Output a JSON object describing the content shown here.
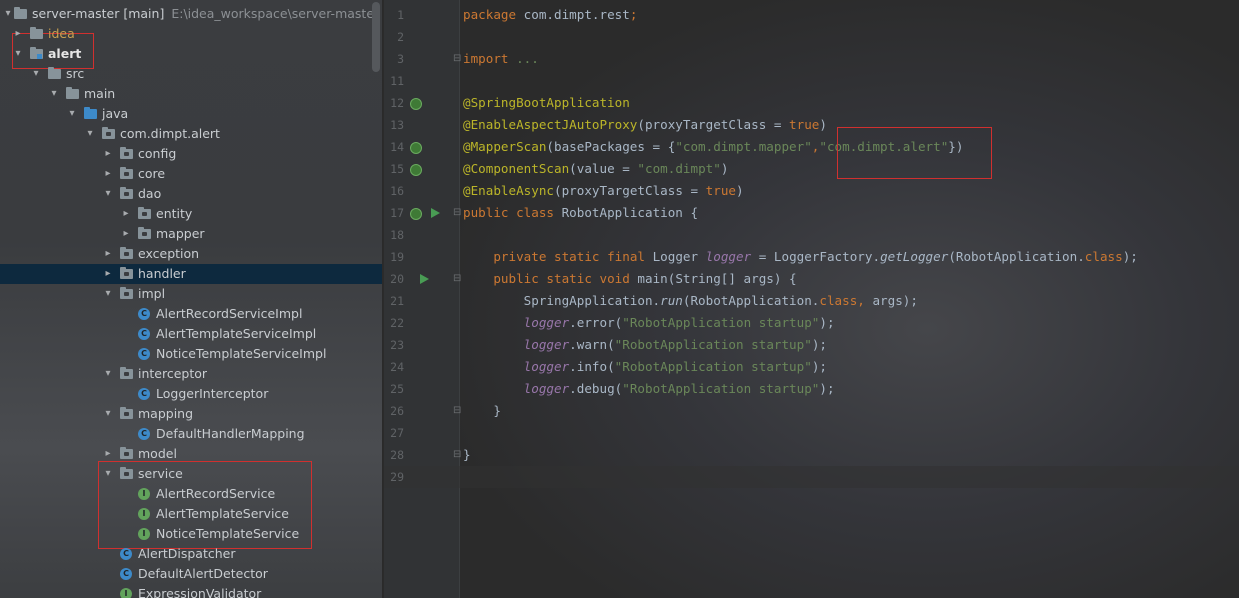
{
  "tree": {
    "project": {
      "name": "server-master [main]",
      "path": "E:\\idea_workspace\\server-master"
    },
    "items": [
      {
        "label": "idea",
        "depth": 1,
        "arrow": "right",
        "icon": "folder-icon"
      },
      {
        "label": "alert",
        "depth": 1,
        "arrow": "down",
        "icon": "module-folder-icon"
      },
      {
        "label": "src",
        "depth": 2,
        "arrow": "down",
        "icon": "folder-icon"
      },
      {
        "label": "main",
        "depth": 3,
        "arrow": "down",
        "icon": "folder-icon"
      },
      {
        "label": "java",
        "depth": 4,
        "arrow": "down",
        "icon": "source-folder-icon"
      },
      {
        "label": "com.dimpt.alert",
        "depth": 5,
        "arrow": "down",
        "icon": "package-icon"
      },
      {
        "label": "config",
        "depth": 6,
        "arrow": "right",
        "icon": "package-icon"
      },
      {
        "label": "core",
        "depth": 6,
        "arrow": "right",
        "icon": "package-icon"
      },
      {
        "label": "dao",
        "depth": 6,
        "arrow": "down",
        "icon": "package-icon"
      },
      {
        "label": "entity",
        "depth": 7,
        "arrow": "right",
        "icon": "package-icon"
      },
      {
        "label": "mapper",
        "depth": 7,
        "arrow": "right",
        "icon": "package-icon"
      },
      {
        "label": "exception",
        "depth": 6,
        "arrow": "right",
        "icon": "package-icon"
      },
      {
        "label": "handler",
        "depth": 6,
        "arrow": "right",
        "icon": "package-icon"
      },
      {
        "label": "impl",
        "depth": 6,
        "arrow": "down",
        "icon": "package-icon"
      },
      {
        "label": "AlertRecordServiceImpl",
        "depth": 7,
        "arrow": "",
        "icon": "class-icon"
      },
      {
        "label": "AlertTemplateServiceImpl",
        "depth": 7,
        "arrow": "",
        "icon": "class-icon"
      },
      {
        "label": "NoticeTemplateServiceImpl",
        "depth": 7,
        "arrow": "",
        "icon": "class-icon"
      },
      {
        "label": "interceptor",
        "depth": 6,
        "arrow": "down",
        "icon": "package-icon"
      },
      {
        "label": "LoggerInterceptor",
        "depth": 7,
        "arrow": "",
        "icon": "class-icon"
      },
      {
        "label": "mapping",
        "depth": 6,
        "arrow": "down",
        "icon": "package-icon"
      },
      {
        "label": "DefaultHandlerMapping",
        "depth": 7,
        "arrow": "",
        "icon": "class-icon"
      },
      {
        "label": "model",
        "depth": 6,
        "arrow": "right",
        "icon": "package-icon"
      },
      {
        "label": "service",
        "depth": 6,
        "arrow": "down",
        "icon": "package-icon"
      },
      {
        "label": "AlertRecordService",
        "depth": 7,
        "arrow": "",
        "icon": "interface-icon"
      },
      {
        "label": "AlertTemplateService",
        "depth": 7,
        "arrow": "",
        "icon": "interface-icon"
      },
      {
        "label": "NoticeTemplateService",
        "depth": 7,
        "arrow": "",
        "icon": "interface-icon"
      },
      {
        "label": "AlertDispatcher",
        "depth": 6,
        "arrow": "",
        "icon": "class-icon"
      },
      {
        "label": "DefaultAlertDetector",
        "depth": 6,
        "arrow": "",
        "icon": "class-icon"
      },
      {
        "label": "ExpressionValidator",
        "depth": 6,
        "arrow": "",
        "icon": "interface-icon"
      }
    ],
    "selected": "handler",
    "bold": "alert"
  },
  "editor": {
    "lines": [
      {
        "n": "1",
        "tokens": [
          [
            "kw",
            "package "
          ],
          [
            "",
            "com.dimpt.rest"
          ],
          [
            "kw",
            ";"
          ]
        ]
      },
      {
        "n": "2",
        "tokens": []
      },
      {
        "n": "3",
        "tokens": [
          [
            "kw",
            "import "
          ],
          [
            "str",
            "..."
          ]
        ]
      },
      {
        "n": "11",
        "tokens": []
      },
      {
        "n": "12",
        "tokens": [
          [
            "ann",
            "@SpringBootApplication"
          ]
        ]
      },
      {
        "n": "13",
        "tokens": [
          [
            "ann",
            "@EnableAspectJAutoProxy"
          ],
          [
            "",
            "(proxyTargetClass = "
          ],
          [
            "kw",
            "true"
          ],
          [
            "",
            ")"
          ]
        ]
      },
      {
        "n": "14",
        "tokens": [
          [
            "ann",
            "@MapperScan"
          ],
          [
            "",
            "(basePackages = {"
          ],
          [
            "str",
            "\"com.dimpt.mapper\""
          ],
          [
            "kw",
            ","
          ],
          [
            "str",
            "\"com.dimpt.alert\""
          ],
          [
            "",
            "})"
          ]
        ]
      },
      {
        "n": "15",
        "tokens": [
          [
            "ann",
            "@ComponentScan"
          ],
          [
            "",
            "(value = "
          ],
          [
            "str",
            "\"com.dimpt\""
          ],
          [
            "",
            ")"
          ]
        ]
      },
      {
        "n": "16",
        "tokens": [
          [
            "ann",
            "@EnableAsync"
          ],
          [
            "",
            "(proxyTargetClass = "
          ],
          [
            "kw",
            "true"
          ],
          [
            "",
            ")"
          ]
        ]
      },
      {
        "n": "17",
        "tokens": [
          [
            "kw",
            "public class "
          ],
          [
            "",
            "RobotApplication {"
          ]
        ]
      },
      {
        "n": "18",
        "tokens": []
      },
      {
        "n": "19",
        "tokens": [
          [
            "",
            "    "
          ],
          [
            "kw",
            "private static final "
          ],
          [
            "",
            "Logger "
          ],
          [
            "fld",
            "logger"
          ],
          [
            "",
            " = LoggerFactory."
          ],
          [
            "it",
            "getLogger"
          ],
          [
            "",
            "(RobotApplication."
          ],
          [
            "kw",
            "class"
          ],
          [
            "",
            ");"
          ]
        ]
      },
      {
        "n": "20",
        "tokens": [
          [
            "",
            "    "
          ],
          [
            "kw",
            "public static void "
          ],
          [
            "",
            "main(String[] args) {"
          ]
        ]
      },
      {
        "n": "21",
        "tokens": [
          [
            "",
            "        SpringApplication."
          ],
          [
            "it",
            "run"
          ],
          [
            "",
            "(RobotApplication."
          ],
          [
            "kw",
            "class"
          ],
          [
            "kw",
            ", "
          ],
          [
            "",
            "args);"
          ]
        ]
      },
      {
        "n": "22",
        "tokens": [
          [
            "",
            "        "
          ],
          [
            "fld",
            "logger"
          ],
          [
            "",
            ".error("
          ],
          [
            "str",
            "\"RobotApplication startup\""
          ],
          [
            "",
            ");"
          ]
        ]
      },
      {
        "n": "23",
        "tokens": [
          [
            "",
            "        "
          ],
          [
            "fld",
            "logger"
          ],
          [
            "",
            ".warn("
          ],
          [
            "str",
            "\"RobotApplication startup\""
          ],
          [
            "",
            ");"
          ]
        ]
      },
      {
        "n": "24",
        "tokens": [
          [
            "",
            "        "
          ],
          [
            "fld",
            "logger"
          ],
          [
            "",
            ".info("
          ],
          [
            "str",
            "\"RobotApplication startup\""
          ],
          [
            "",
            ");"
          ]
        ]
      },
      {
        "n": "25",
        "tokens": [
          [
            "",
            "        "
          ],
          [
            "fld",
            "logger"
          ],
          [
            "",
            ".debug("
          ],
          [
            "str",
            "\"RobotApplication startup\""
          ],
          [
            "",
            ");"
          ]
        ]
      },
      {
        "n": "26",
        "tokens": [
          [
            "",
            "    }"
          ]
        ]
      },
      {
        "n": "27",
        "tokens": []
      },
      {
        "n": "28",
        "tokens": [
          [
            "",
            "}"
          ]
        ]
      },
      {
        "n": "29",
        "tokens": []
      }
    ]
  },
  "colors": {
    "keyword": "#cc7832",
    "annotation": "#bbb529",
    "string": "#6a8759",
    "field": "#9876aa",
    "highlight_box": "#d0302f"
  }
}
